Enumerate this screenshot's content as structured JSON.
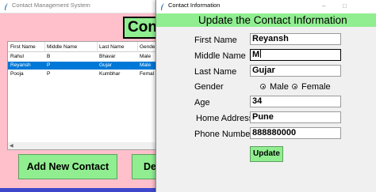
{
  "main_window": {
    "title": "Contact Management System",
    "heading_button": "Cont",
    "table": {
      "columns": [
        "First Name",
        "Middle Name",
        "Last Name",
        "Gende"
      ],
      "rows": [
        {
          "first": "Rahul",
          "middle": "B",
          "last": "Bhavar",
          "gender": "Male"
        },
        {
          "first": "Reyansh",
          "middle": "P",
          "last": "Gujar",
          "gender": "Male"
        },
        {
          "first": "Pooja",
          "middle": "P",
          "last": "Kumbhar",
          "gender": "Femal"
        }
      ],
      "selected_row": 1
    },
    "add_button": "Add New Contact",
    "delete_button": "De"
  },
  "dialog": {
    "title": "Contact Information",
    "header": "Update the Contact Information",
    "window_controls": {
      "minimize": "–",
      "maximize": "□"
    },
    "labels": {
      "first_name": "First Name",
      "middle_name": "Middle Name",
      "last_name": "Last Name",
      "gender": "Gender",
      "age": "Age",
      "home_address": "Home Address",
      "phone_number": "Phone Number"
    },
    "values": {
      "first_name": "Reyansh",
      "middle_name": "M",
      "last_name": "Gujar",
      "age": "34",
      "home_address": "Pune",
      "phone_number": "888880000"
    },
    "gender_options": [
      "Male",
      "Female"
    ],
    "gender_selected": "Male",
    "update_button": "Update"
  },
  "colors": {
    "main_background": "#ffc0cb",
    "accent_green": "#90ee90",
    "selection_blue": "#0078d7",
    "taskbar_strip": "#3f48cc"
  },
  "icons": {
    "app_icon": "feather-icon"
  }
}
